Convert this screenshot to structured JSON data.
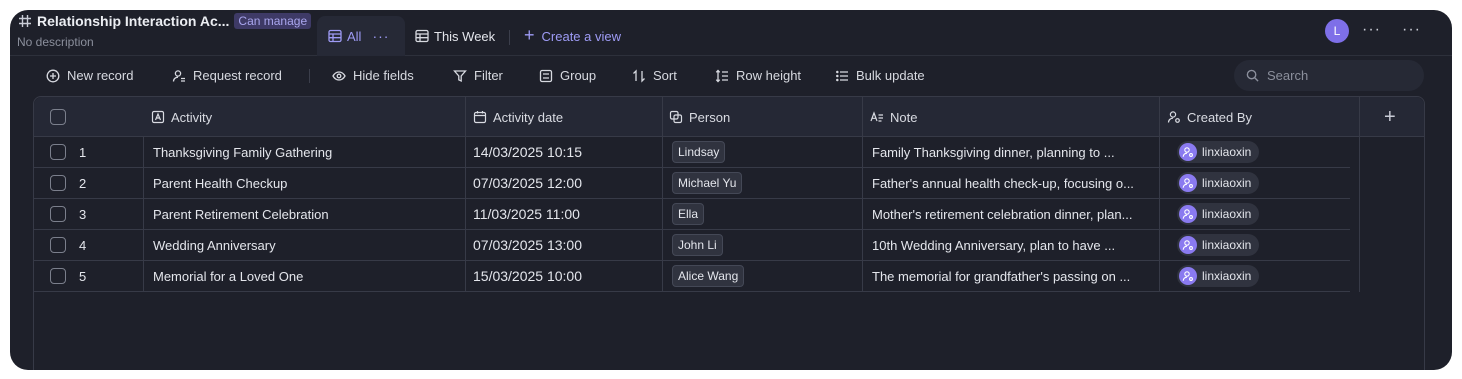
{
  "header": {
    "title": "Relationship Interaction Ac...",
    "permission": "Can manage",
    "description": "No description",
    "avatar_letter": "L",
    "more_glyph": "···"
  },
  "tabs": [
    {
      "label": "All",
      "active": true
    },
    {
      "label": "This Week",
      "active": false
    }
  ],
  "create_view_label": "Create a view",
  "toolbar": {
    "new_record": "New record",
    "request_record": "Request record",
    "hide_fields": "Hide fields",
    "filter": "Filter",
    "group": "Group",
    "sort": "Sort",
    "row_height": "Row height",
    "bulk_update": "Bulk update",
    "search_placeholder": "Search"
  },
  "columns": [
    {
      "label": "Activity",
      "icon": "text-field-icon"
    },
    {
      "label": "Activity date",
      "icon": "calendar-icon"
    },
    {
      "label": "Person",
      "icon": "single-select-icon"
    },
    {
      "label": "Note",
      "icon": "long-text-icon"
    },
    {
      "label": "Created By",
      "icon": "user-field-icon"
    }
  ],
  "add_column_glyph": "+",
  "rows": [
    {
      "num": "1",
      "activity": "Thanksgiving Family Gathering",
      "date": "14/03/2025 10:15",
      "person": "Lindsay",
      "note": "Family Thanksgiving dinner, planning to ...",
      "created_by": "linxiaoxin"
    },
    {
      "num": "2",
      "activity": "Parent Health Checkup",
      "date": "07/03/2025 12:00",
      "person": "Michael Yu",
      "note": "Father's annual health check-up, focusing o...",
      "created_by": "linxiaoxin"
    },
    {
      "num": "3",
      "activity": "Parent Retirement Celebration",
      "date": "11/03/2025 11:00",
      "person": "Ella",
      "note": "Mother's retirement celebration dinner, plan...",
      "created_by": "linxiaoxin"
    },
    {
      "num": "4",
      "activity": "Wedding Anniversary",
      "date": "07/03/2025 13:00",
      "person": "John Li",
      "note": "10th Wedding Anniversary, plan to have ...",
      "created_by": "linxiaoxin"
    },
    {
      "num": "5",
      "activity": "Memorial for a Loved One",
      "date": "15/03/2025 10:00",
      "person": "Alice Wang",
      "note": "The memorial for grandfather's passing on ...",
      "created_by": "linxiaoxin"
    }
  ],
  "colors": {
    "background": "#1e202a",
    "accent": "#9e9bf5",
    "avatar": "#7e6fe8"
  }
}
